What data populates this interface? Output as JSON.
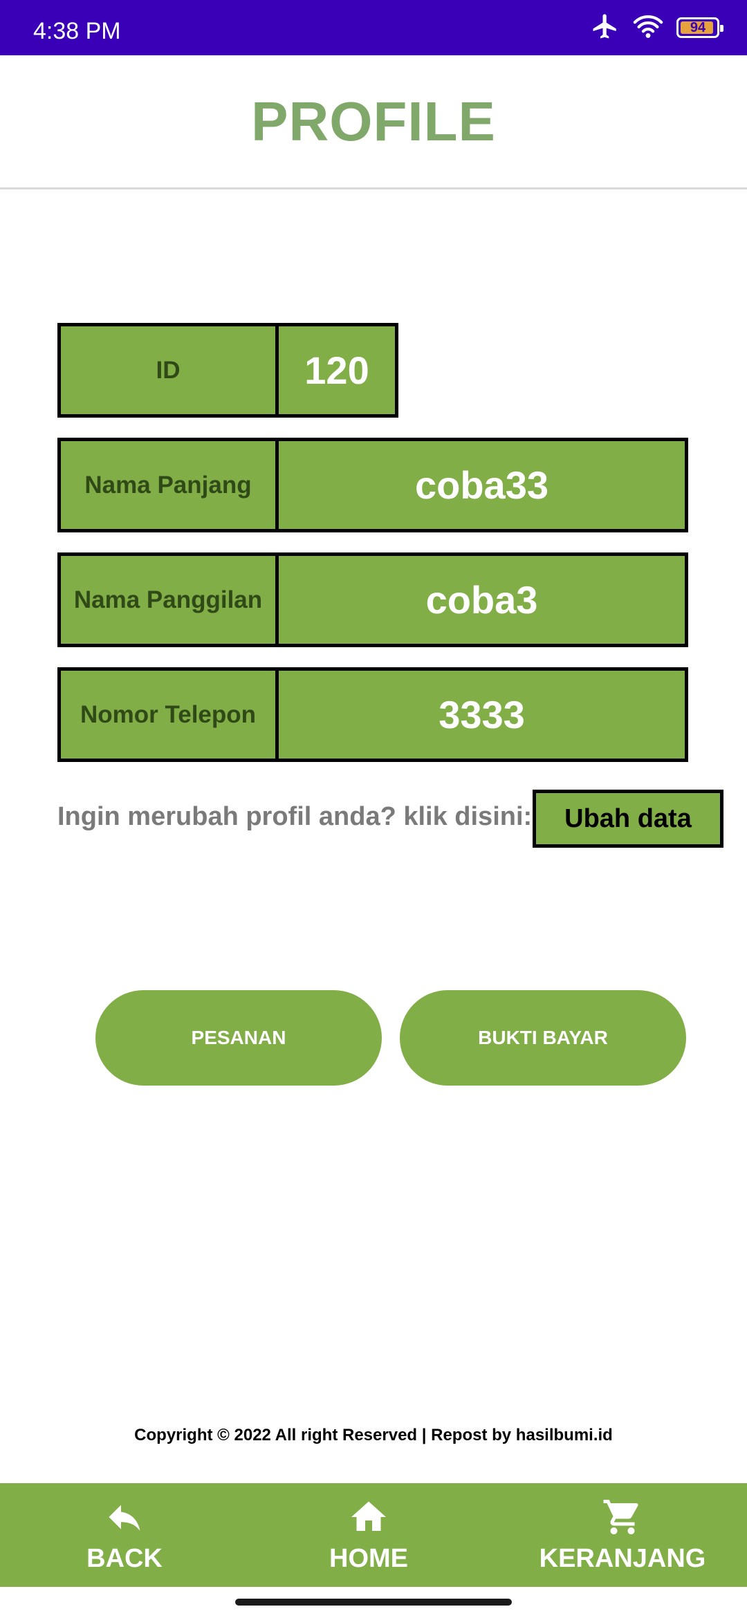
{
  "status_bar": {
    "time": "4:38 PM",
    "battery_level": "94",
    "battery_fraction": 0.94,
    "icons": [
      "airplane-mode-icon",
      "wifi-icon",
      "battery-icon"
    ]
  },
  "header": {
    "title": "PROFILE"
  },
  "profile": {
    "fields": [
      {
        "label": "ID",
        "value": "120"
      },
      {
        "label": "Nama Panjang",
        "value": "coba33"
      },
      {
        "label": "Nama Panggilan",
        "value": "coba3"
      },
      {
        "label": "Nomor Telepon",
        "value": "3333"
      }
    ]
  },
  "change_prompt": {
    "text": "Ingin merubah profil anda? klik disini:",
    "button_label": "Ubah data"
  },
  "actions": {
    "orders_label": "PESANAN",
    "payment_proof_label": "BUKTI BAYAR"
  },
  "footer": {
    "copyright": "Copyright © 2022 All right Reserved | Repost by hasilbumi.id"
  },
  "bottom_nav": {
    "back_label": "BACK",
    "home_label": "HOME",
    "cart_label": "KERANJANG",
    "icons": [
      "back-arrow-icon",
      "home-icon",
      "cart-icon"
    ]
  },
  "colors": {
    "status_bar": "#3a00b8",
    "accent_green": "#82ae48",
    "title_green": "#7fa86a",
    "label_text": "#2f4a17"
  }
}
